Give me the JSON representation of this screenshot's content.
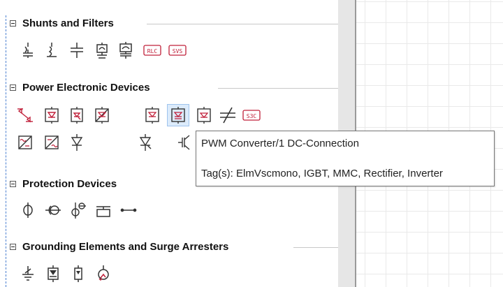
{
  "sections": [
    {
      "title": "Shunts and Filters"
    },
    {
      "title": "Power Electronic Devices"
    },
    {
      "title": "Protection Devices"
    },
    {
      "title": "Grounding Elements and Surge Arresters"
    }
  ],
  "icon_labels": {
    "rlc": "RLC",
    "svs": "SVS",
    "s3c": "S3C"
  },
  "tooltip": {
    "title": "PWM Converter/1 DC-Connection",
    "tags": "Tag(s): ElmVscmono, IGBT, MMC, Rectifier, Inverter"
  },
  "colors": {
    "accent_red": "#c0203a",
    "icon_gray": "#333333",
    "hover_bg": "#dcebfb"
  }
}
